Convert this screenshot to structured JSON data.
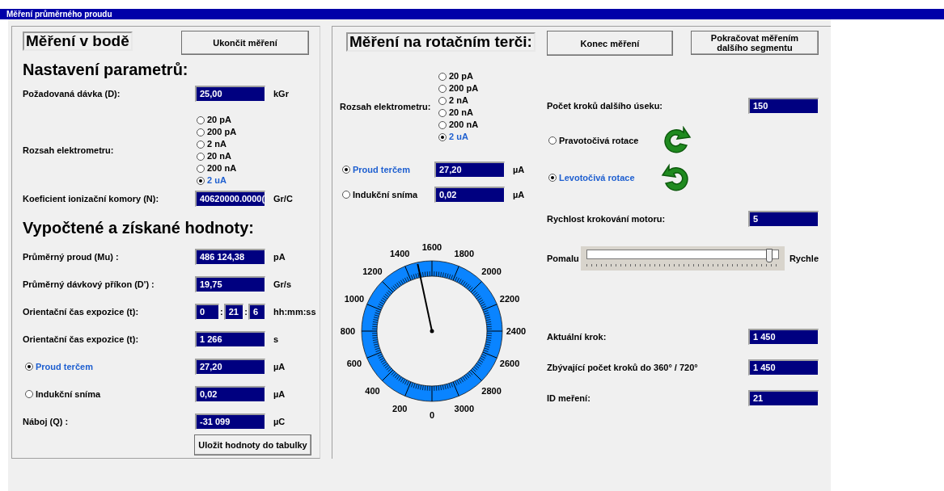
{
  "window": {
    "title": "Měření průměrného proudu"
  },
  "point_panel": {
    "title": "Měření v bodě",
    "end_button": "Ukončit měření",
    "settings_heading": "Nastavení parametrů:",
    "dose": {
      "label": "Požadovaná dávka (D):",
      "value": "25,00",
      "unit": "kGr"
    },
    "range": {
      "label": "Rozsah elektrometru:",
      "options": [
        {
          "label": "20 pA",
          "selected": false
        },
        {
          "label": "200 pA",
          "selected": false
        },
        {
          "label": "2 nA",
          "selected": false
        },
        {
          "label": "20 nA",
          "selected": false
        },
        {
          "label": "200 nA",
          "selected": false
        },
        {
          "label": "2 uA",
          "selected": true
        }
      ]
    },
    "coefficient": {
      "label": "Koeficient ionizační komory (N):",
      "value": "40620000.0000(",
      "unit": "Gr/C"
    },
    "results_heading": "Vypočtené a získané hodnoty:",
    "results": [
      {
        "kind": "field",
        "label": "Průměrný proud (Mu) :",
        "value": "486 124,38",
        "unit": "pA"
      },
      {
        "kind": "field",
        "label": "Průměrný dávkový příkon (D') :",
        "value": "19,75",
        "unit": "Gr/s"
      },
      {
        "kind": "time",
        "label": "Orientační čas expozice (t):",
        "values": [
          "0",
          "21",
          "6"
        ],
        "separators": [
          ":",
          ":"
        ],
        "unit": "hh:mm:ss"
      },
      {
        "kind": "field",
        "label": "Orientační čas expozice (t):",
        "value": "1 266",
        "unit": "s"
      },
      {
        "kind": "radio",
        "label": "Proud terčem",
        "selected": true,
        "value": "27,20",
        "unit": "µA"
      },
      {
        "kind": "radio",
        "label": "Indukční sníma",
        "selected": false,
        "value": "0,02",
        "unit": "µA"
      },
      {
        "kind": "field",
        "label": "Náboj (Q) :",
        "value": "-31 099",
        "unit": "µC"
      }
    ],
    "save_button": "Uložit hodnoty do tabulky"
  },
  "rotary_panel": {
    "title": "Měření na rotačním terči:",
    "end_button": "Konec měření",
    "continue_button": "Pokračovat měřením dalšího segmentu",
    "range": {
      "label": "Rozsah elektrometru:",
      "options": [
        {
          "label": "20 pA",
          "selected": false
        },
        {
          "label": "200 pA",
          "selected": false
        },
        {
          "label": "2 nA",
          "selected": false
        },
        {
          "label": "20 nA",
          "selected": false
        },
        {
          "label": "200 nA",
          "selected": false
        },
        {
          "label": "2 uA",
          "selected": true
        }
      ]
    },
    "sources": [
      {
        "label": "Proud terčem",
        "selected": true,
        "value": "27,20",
        "unit": "µA"
      },
      {
        "label": "Indukční sníma",
        "selected": false,
        "value": "0,02",
        "unit": "µA"
      }
    ],
    "dial": {
      "labels": [
        "0",
        "200",
        "400",
        "600",
        "800",
        "1000",
        "1200",
        "1400",
        "1600",
        "1800",
        "2000",
        "2200",
        "2400",
        "2600",
        "2800",
        "3000"
      ]
    },
    "next_steps": {
      "label": "Počet kroků dalšího úseku:",
      "value": "150"
    },
    "rotations": [
      {
        "kind": "clockwise",
        "label": "Pravotočivá rotace",
        "selected": false
      },
      {
        "kind": "counterclockwise",
        "label": "Levotočivá rotace",
        "selected": true
      }
    ],
    "speed": {
      "label": "Rychlost krokování motoru:",
      "value": "5"
    },
    "speed_slider": {
      "min_label": "Pomalu",
      "max_label": "Rychle",
      "level": 0.97
    },
    "readouts": [
      {
        "label": "Aktuální krok:",
        "value": "1 450"
      },
      {
        "label": "Zbývající počet kroků do 360° / 720°",
        "value": "1 450"
      },
      {
        "label": "ID meření:",
        "value": "21"
      }
    ]
  }
}
